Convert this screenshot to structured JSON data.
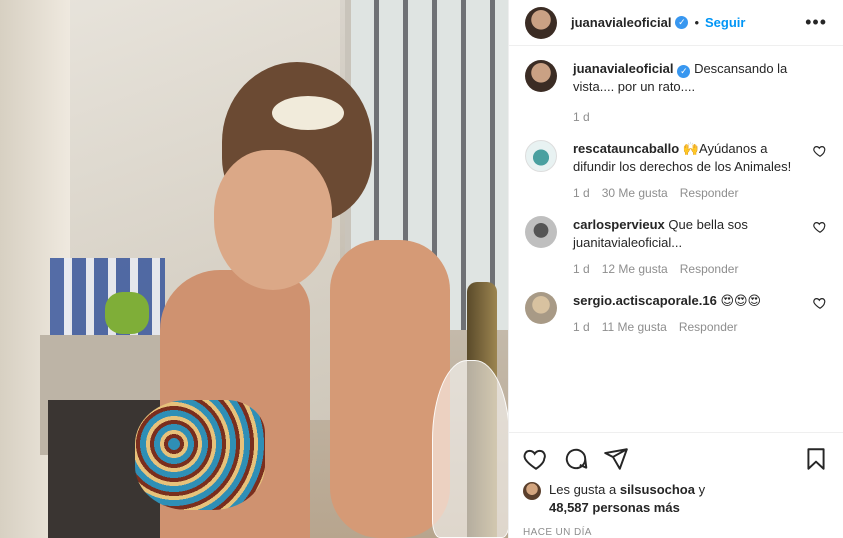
{
  "header": {
    "username": "juanavialeoficial",
    "follow_label": "Seguir",
    "separator": "•",
    "more_label": "•••"
  },
  "caption": {
    "username": "juanavialeoficial",
    "text": "Descansando la vista.... por un rato....",
    "time": "1 d"
  },
  "comments": [
    {
      "username": "rescatauncaballo",
      "text": "🙌Ayúdanos a difundir los derechos de los Animales!",
      "time": "1 d",
      "likes": "30 Me gusta",
      "reply_label": "Responder"
    },
    {
      "username": "carlospervieux",
      "text": "Que bella sos juanitavialeoficial...",
      "time": "1 d",
      "likes": "12 Me gusta",
      "reply_label": "Responder"
    },
    {
      "username": "sergio.actiscaporale.16",
      "text": "😍😍😍",
      "time": "1 d",
      "likes": "11 Me gusta",
      "reply_label": "Responder"
    }
  ],
  "likes": {
    "prefix": "Les gusta a",
    "user": "silsusochoa",
    "connector": "y",
    "others": "48,587 personas más"
  },
  "posted_ago": "HACE UN DÍA",
  "colors": {
    "link_blue": "#0095f6",
    "verified": "#3897f0",
    "muted": "#8e8e8e",
    "text": "#262626"
  },
  "icons": [
    "heart-icon",
    "comment-icon",
    "share-icon",
    "bookmark-icon",
    "verified-icon",
    "more-icon"
  ]
}
